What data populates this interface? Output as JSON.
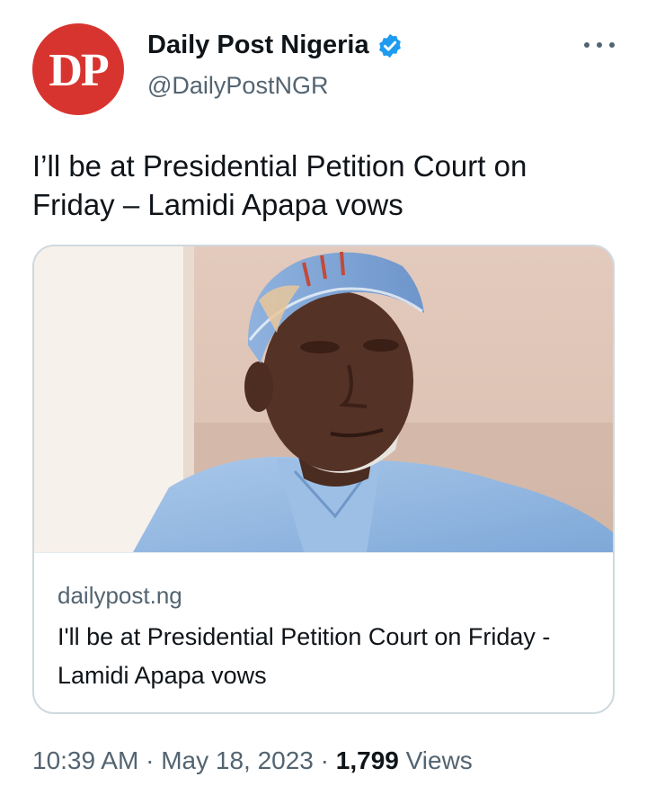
{
  "account": {
    "avatar_text": "DP",
    "display_name": "Daily Post Nigeria",
    "handle": "@DailyPostNGR",
    "verified": true,
    "avatar_color": "#d8342f",
    "verified_color": "#1d9bf0"
  },
  "tweet": {
    "text": "I’ll be at Presidential Petition Court on Friday – Lamidi Apapa vows"
  },
  "card": {
    "domain": "dailypost.ng",
    "title": "I'll be at Presidential Petition Court on Friday - Lamidi Apapa vows",
    "image_icon": "article-photo"
  },
  "meta": {
    "time": "10:39 AM",
    "separator": "·",
    "date": "May 18, 2023",
    "views_count": "1,799",
    "views_label": "Views"
  },
  "icons": {
    "more": "more-dots-icon",
    "verified": "verified-badge-icon"
  }
}
